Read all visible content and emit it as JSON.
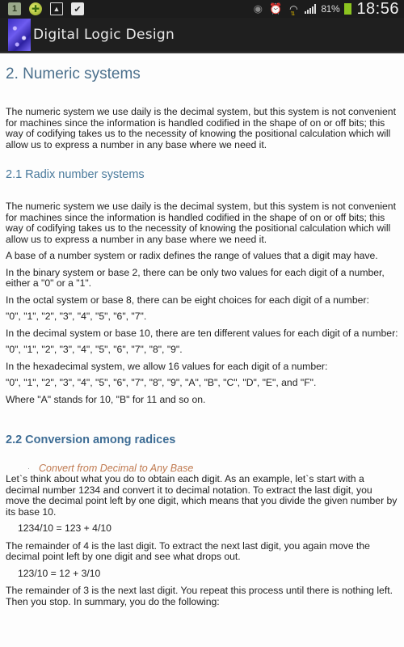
{
  "status_bar": {
    "notifications": [
      "1",
      "plus-circle",
      "image",
      "shopping-bag-check"
    ],
    "icons": [
      "eye-icon",
      "alarm-icon",
      "wifi-icon",
      "signal-icon"
    ],
    "battery_percent": "81%",
    "time": "18:56",
    "battery_color": "#8cc420"
  },
  "app_bar": {
    "title": "Digital Logic Design"
  },
  "content": {
    "section_title": "2. Numeric systems",
    "section_intro": "The numeric system we use daily is the decimal system, but this system is not convenient for machines since the information is handled codified in the shape of on or off bits; this way of codifying takes us to the necessity of knowing the positional calculation which will allow us to express a number in any base where we need it.",
    "subsection_1": {
      "title": "2.1 Radix number systems",
      "paragraphs": [
        "The numeric system we use daily is the decimal system, but this system is not convenient for machines since the information is handled codified in the shape of on or off bits; this way of codifying takes us to the necessity of knowing the positional calculation which will allow us to express a number in any base where we need it.",
        "A base of a number system or radix defines the range of values that a digit may have.",
        "In the binary system or base 2, there can be only two values for each digit of a number, either a \"0\" or a \"1\".",
        "In the octal system or base 8, there can be eight choices for each digit of a number:",
        "\"0\", \"1\", \"2\", \"3\", \"4\", \"5\", \"6\", \"7\".",
        "In the decimal system or base 10, there are ten different values for each digit of a number:",
        "\"0\", \"1\", \"2\", \"3\", \"4\", \"5\", \"6\", \"7\", \"8\", \"9\".",
        "In the hexadecimal system, we allow 16 values for each digit of a number:",
        "\"0\", \"1\", \"2\", \"3\", \"4\", \"5\", \"6\", \"7\", \"8\", \"9\", \"A\", \"B\", \"C\", \"D\", \"E\", and \"F\".",
        "Where \"A\" stands for 10, \"B\" for 11 and so on."
      ]
    },
    "subsection_2": {
      "title": "2.2 Conversion among radices",
      "bullet": "·",
      "bullet_title": "Convert from Decimal to Any Base",
      "p1": "Let`s think about what you do to obtain each digit. As an example, let`s start with a decimal number 1234 and convert it to decimal notation. To extract the last digit, you move the decimal point left by one digit, which means that you divide the given number by its base 10.",
      "formula1": "1234/10 = 123 + 4/10",
      "p2": "The remainder of 4 is the last digit. To extract the next last digit, you again move the decimal point left by one digit and see what drops out.",
      "formula2": "123/10 = 12 + 3/10",
      "p3": "The remainder of 3 is the next last digit. You repeat this process until there is nothing left. Then you stop. In summary, you do the following:"
    }
  }
}
